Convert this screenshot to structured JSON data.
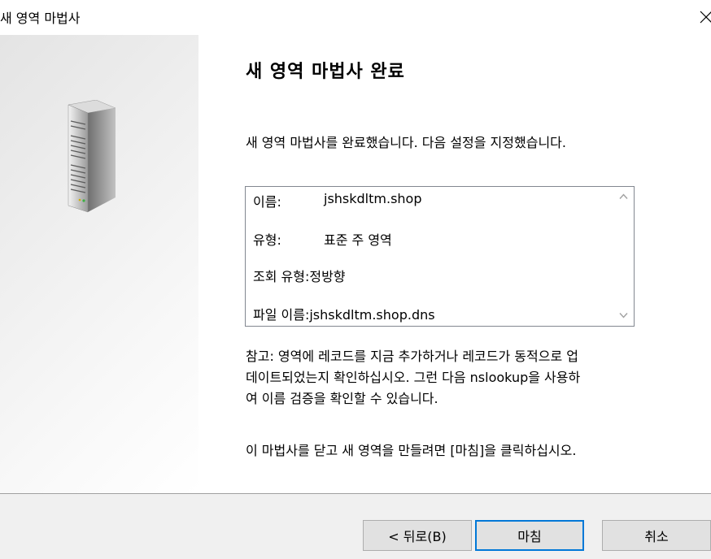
{
  "window": {
    "title": "새 영역 마법사",
    "close_icon": "close-icon"
  },
  "side_panel": {
    "icon": "server-icon"
  },
  "page": {
    "title": "새 영역 마법사 완료",
    "intro": "새 영역 마법사를 완료했습니다. 다음 설정을 지정했습니다."
  },
  "settings": {
    "name_label": "이름:",
    "name_value": "jshskdltm.shop",
    "type_label": "유형:",
    "type_value": "표준 주 영역",
    "lookup_label": "조회 유형:",
    "lookup_value": "정방향",
    "file_label": "파일 이름:",
    "file_value": "jshskdltm.shop.dns",
    "scroll_up_icon": "chevron-up-icon",
    "scroll_down_icon": "chevron-down-icon"
  },
  "note": {
    "lines": [
      "참고: 영역에 레코드를 지금 추가하거나 레코드가 동적으로 업",
      "데이트되었는지 확인하십시오. 그런 다음 nslookup을 사용하",
      "여 이름 검증을 확인할 수 있습니다."
    ]
  },
  "finish_hint": "이 마법사를 닫고 새 영역을 만들려면 [마침]을 클릭하십시오.",
  "buttons": {
    "back": "< 뒤로(B)",
    "finish": "마침",
    "cancel": "취소"
  },
  "colors": {
    "default_button_border": "#0078d7",
    "footer_background": "#f0f0f0"
  }
}
